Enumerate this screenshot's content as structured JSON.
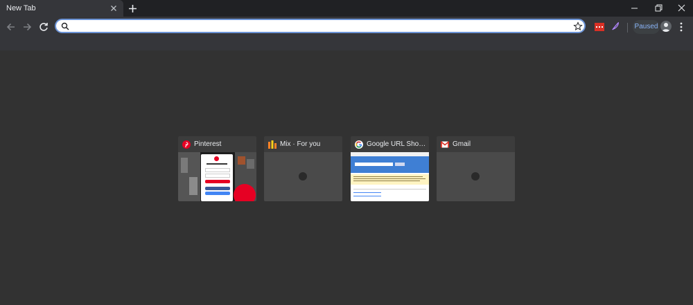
{
  "browser": {
    "tab": {
      "title": "New Tab"
    },
    "window_controls": {
      "minimize": "minimize-icon",
      "restore": "restore-icon",
      "close": "close-icon"
    },
    "toolbar": {
      "omnibox": {
        "value": "",
        "placeholder": ""
      },
      "profile_status": "Paused",
      "accent": "#6b93d6"
    }
  },
  "tiles": [
    {
      "title": "Pinterest",
      "favicon": "pinterest-icon"
    },
    {
      "title": "Mix · For you",
      "favicon": "mix-icon"
    },
    {
      "title": "Google URL Shorte...",
      "favicon": "google-icon"
    },
    {
      "title": "Gmail",
      "favicon": "gmail-icon"
    }
  ]
}
